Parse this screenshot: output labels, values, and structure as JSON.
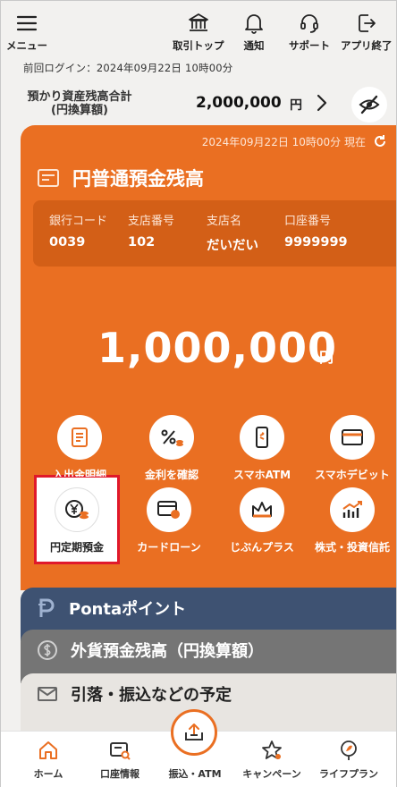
{
  "topnav": {
    "menu": "メニュー",
    "torihiki": "取引トップ",
    "tsuchi": "通知",
    "support": "サポート",
    "exit": "アプリ終了"
  },
  "last_login": "前回ログイン：2024年09月22日 10時00分",
  "assets": {
    "label_line1": "預かり資産残高合計",
    "label_line2": "(円換算額)",
    "amount": "2,000,000",
    "unit": "円"
  },
  "card": {
    "date": "2024年09月22日 10時00分 現在",
    "title": "円普通預金残高",
    "bank_code_label": "銀行コード",
    "bank_code": "0039",
    "branch_no_label": "支店番号",
    "branch_no": "102",
    "branch_name_label": "支店名",
    "branch_name": "だいだい",
    "account_no_label": "口座番号",
    "account_no": "9999999",
    "balance": "1,000,000",
    "balance_unit": "円",
    "actions": [
      "入出金明細",
      "金利を確認",
      "スマホATM",
      "スマホデビット",
      "円定期預金",
      "カードローン",
      "じぶんプラス",
      "株式・投資信託"
    ]
  },
  "stack": {
    "ponta": "Pontaポイント",
    "fx": "外貨預金残高（円換算額）",
    "sched": "引落・振込などの予定"
  },
  "bottomnav": {
    "home": "ホーム",
    "acct": "口座情報",
    "transfer": "振込・ATM",
    "camp": "キャンペーン",
    "life": "ライフプラン"
  },
  "colors": {
    "accent": "#ea6f22",
    "highlight_border": "#e0192b",
    "ponta": "#3e5272",
    "fx": "#757575"
  }
}
